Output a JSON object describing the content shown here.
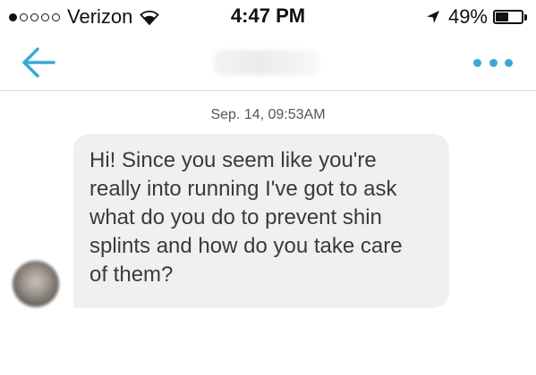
{
  "status_bar": {
    "signal_dots_filled": 1,
    "signal_dots_total": 5,
    "carrier": "Verizon",
    "time": "4:47 PM",
    "battery_percent": "49%",
    "battery_level": 0.49,
    "icons": [
      "signal-dots-icon",
      "wifi-icon",
      "location-arrow-icon",
      "battery-icon"
    ]
  },
  "nav_bar": {
    "back_icon": "arrow-left-icon",
    "title_blurred": true,
    "more_icon": "ellipsis-icon",
    "accent_color": "#38a9d6"
  },
  "conversation": {
    "timestamp": "Sep. 14, 09:53AM",
    "messages": [
      {
        "sender": "other",
        "avatar_blurred": true,
        "text": "Hi! Since you seem like you're\nreally into running I've got to ask\nwhat do you do to prevent shin\nsplints and how do you take care\nof them?"
      }
    ]
  }
}
